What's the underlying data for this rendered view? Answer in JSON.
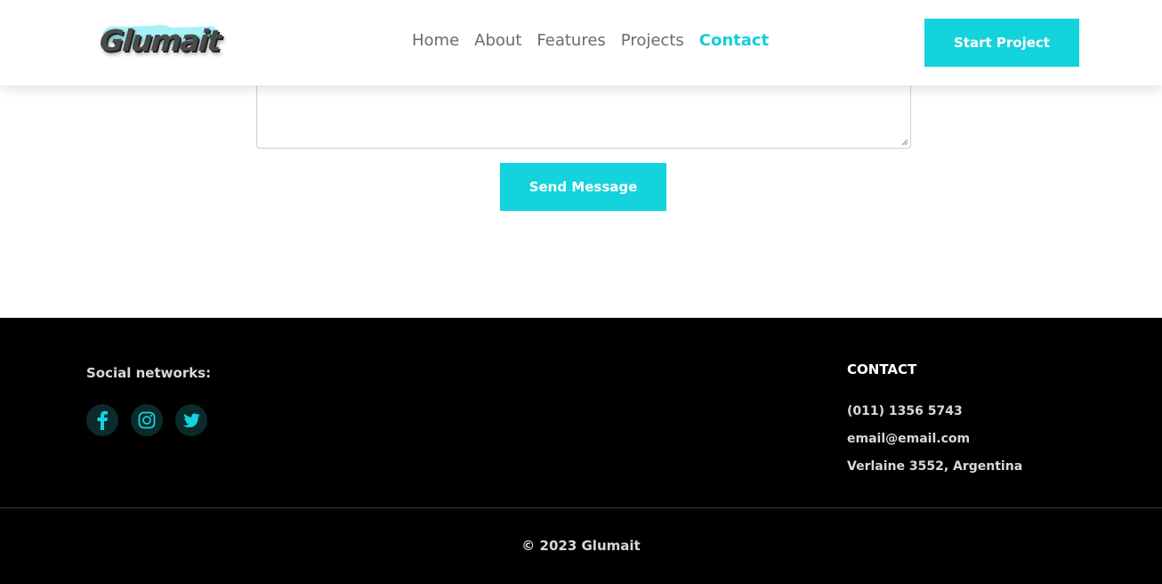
{
  "header": {
    "logo_text": "Glumait",
    "nav": [
      "Home",
      "About",
      "Features",
      "Projects",
      "Contact"
    ],
    "active_nav": "Contact",
    "start_button": "Start Project",
    "accent_color": "#13d3dc"
  },
  "form": {
    "message_value": "",
    "send_button": "Send Message"
  },
  "footer": {
    "social_title": "Social networks:",
    "social_icons": [
      "facebook-icon",
      "instagram-icon",
      "twitter-icon"
    ],
    "contact_title": "CONTACT",
    "phone": "(011) 1356 5743",
    "email": "email@email.com",
    "address": "Verlaine 3552, Argentina",
    "copyright": "© 2023 Glumait"
  }
}
